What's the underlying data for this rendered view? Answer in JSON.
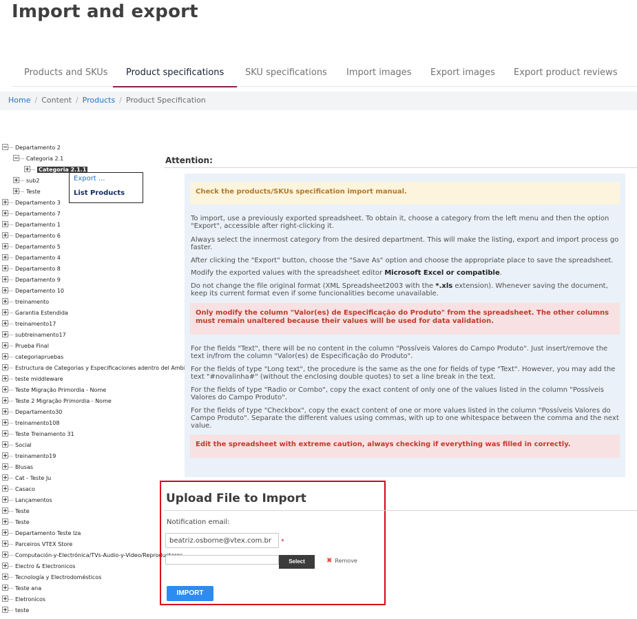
{
  "page_title": "Import and export",
  "tabs": [
    {
      "label": "Products and SKUs"
    },
    {
      "label": "Product specifications",
      "active": true
    },
    {
      "label": "SKU specifications"
    },
    {
      "label": "Import images"
    },
    {
      "label": "Export images"
    },
    {
      "label": "Export product reviews"
    }
  ],
  "breadcrumb": {
    "items": [
      "Home",
      "Content",
      "Products",
      "Product Specification"
    ],
    "separator": "/"
  },
  "tree": {
    "nodes": [
      {
        "label": "Departamento 2",
        "expanded": true,
        "level": 0
      },
      {
        "label": "Categoria 2.1",
        "expanded": true,
        "level": 1
      },
      {
        "label": "Categoria 2.1.1",
        "expanded": false,
        "level": 2,
        "selected": true
      },
      {
        "label": "sub2",
        "expanded": false,
        "level": 1
      },
      {
        "label": "Teste",
        "expanded": false,
        "level": 1
      },
      {
        "label": "Departamento 3",
        "level": 0
      },
      {
        "label": "Departamento 7",
        "level": 0
      },
      {
        "label": "Departamento 1",
        "level": 0
      },
      {
        "label": "Departamento 6",
        "level": 0
      },
      {
        "label": "Departamento 5",
        "level": 0
      },
      {
        "label": "Departamento 4",
        "level": 0
      },
      {
        "label": "Departamento 8",
        "level": 0
      },
      {
        "label": "Departamento 9",
        "level": 0
      },
      {
        "label": "Departamento 10",
        "level": 0
      },
      {
        "label": "treinamento",
        "level": 0
      },
      {
        "label": "Garantia Estendida",
        "level": 0
      },
      {
        "label": "treinamento17",
        "level": 0
      },
      {
        "label": "subtreinamento17",
        "level": 0
      },
      {
        "label": "Prueba Final",
        "level": 0
      },
      {
        "label": "categoriapruebas",
        "level": 0
      },
      {
        "label": "Estructura de Categorias y Especificaciones adentro del Ambiente",
        "level": 0
      },
      {
        "label": "teste middleware",
        "level": 0
      },
      {
        "label": "Teste Migração Primordia - Nome",
        "level": 0
      },
      {
        "label": "Teste 2 Migração Primordia - Nome",
        "level": 0
      },
      {
        "label": "Departamento30",
        "level": 0
      },
      {
        "label": "treinamento108",
        "level": 0
      },
      {
        "label": "Teste Treinamento 31",
        "level": 0
      },
      {
        "label": "Social",
        "level": 0
      },
      {
        "label": "treinamento19",
        "level": 0
      },
      {
        "label": "Blusas",
        "level": 0
      },
      {
        "label": "Cat - Teste Ju",
        "level": 0
      },
      {
        "label": "Casaco",
        "level": 0
      },
      {
        "label": "Lançamentos",
        "level": 0
      },
      {
        "label": "Teste",
        "level": 0
      },
      {
        "label": "Teste",
        "level": 0
      },
      {
        "label": "Departamento Teste Iza",
        "level": 0
      },
      {
        "label": "Parceiros VTEX Store",
        "level": 0
      },
      {
        "label": "Computación-y-Electrónica/TVs-Audio-y-Video/Reproductores",
        "level": 0
      },
      {
        "label": "Electro & Electronicos",
        "level": 0
      },
      {
        "label": "Tecnología y Electrodomésticos",
        "level": 0
      },
      {
        "label": "Teste ana",
        "level": 0
      },
      {
        "label": "Eletronicos",
        "level": 0
      },
      {
        "label": "teste",
        "level": 0
      }
    ]
  },
  "context_menu": {
    "export": "Export ...",
    "list_products": "List Products"
  },
  "attention": {
    "heading": "Attention:",
    "manual_notice": "Check the products/SKUs specification import manual.",
    "p1": "To import, use a previously exported spreadsheet. To obtain it, choose a category from the left menu and then the option \"Export\", accessible after right-clicking it.",
    "p2": "Always select the innermost category from the desired department. This will make the listing, export and import process go faster.",
    "p3": "After clicking the \"Export\" button, choose the \"Save As\" option and choose the appropriate place to save the spreadsheet.",
    "p4_pre": "Modify the exported values with the spreadsheet editor ",
    "p4_bold": "Microsoft Excel or compatible",
    "p4_post": ".",
    "p5_pre": "Do not change the file original format (XML Spreadsheet2003 with the ",
    "p5_bold": "*.xls",
    "p5_post": " extension). Whenever saving the document, keep its current format even if some funcionalities become unavailable.",
    "warning1": "Only modify the column \"Valor(es) de Especificação do Produto\" from the spreadsheet. The other columns must remain unaltered because their values will be used for data validation.",
    "p6": "For the fields \"Text\", there will be no content in the column \"Possíveis Valores do Campo Produto\". Just insert/remove the text in/from the column \"Valor(es) de Especificação do Produto\".",
    "p7": "For the fields of type \"Long text\", the procedure is the same as the one for fields of type \"Text\". However, you may add the text \"#novalinha#\" (without the enclosing double quotes) to set a line break in the text.",
    "p8": "For the fields of type \"Radio or Combo\", copy the exact content of only one of the values listed in the column \"Possíveis Valores do Campo Produto\".",
    "p9": "For the fields of type \"Checkbox\", copy the exact content of one or more values listed in the column \"Possíveis Valores do Campo Produto\". Separate the different values using commas, with up to one whitespace between the comma and the next value.",
    "warning2": "Edit the spreadsheet with extreme caution, always checking if everything was filled in correctly."
  },
  "upload": {
    "title": "Upload File to Import",
    "email_label": "Notification email:",
    "email_value": "beatriz.osborne@vtex.com.br",
    "required_mark": "*",
    "select_label": "Select",
    "remove_label": "Remove",
    "import_label": "IMPORT"
  },
  "colors": {
    "active_tab": "#8b2144",
    "link": "#2671c5",
    "import_button": "#2d8cf0",
    "highlight_frame": "#d9001b"
  }
}
